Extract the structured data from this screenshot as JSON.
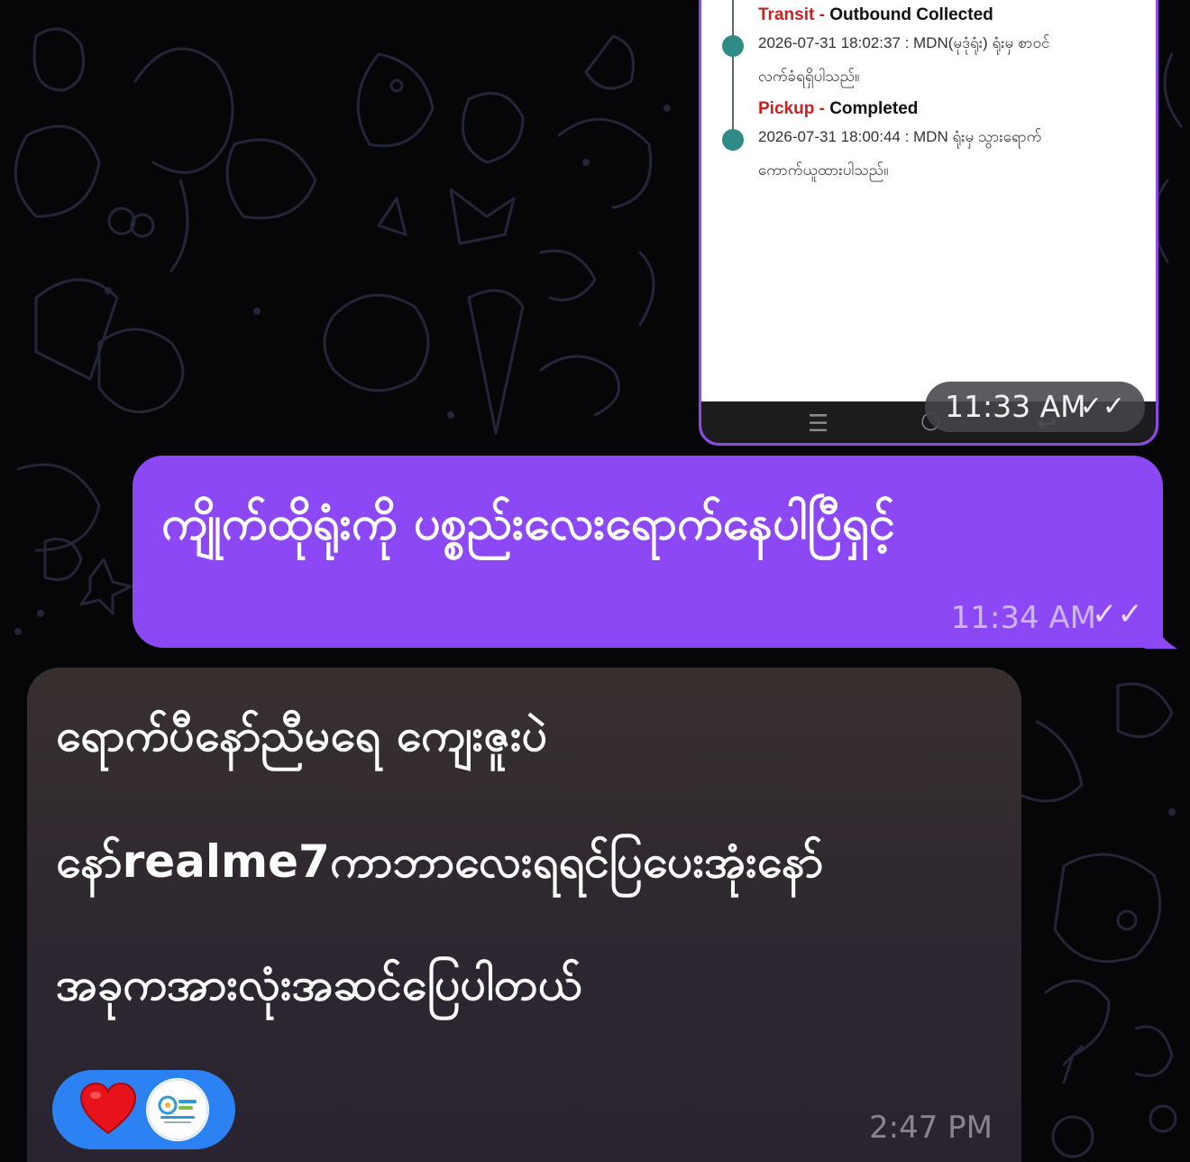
{
  "chat": {
    "image_message": {
      "tracking": [
        {
          "stage": "Transit",
          "dash": "-",
          "status": "Outbound Collected",
          "detail": "2026-07-31 18:02:37 : MDN(မုဒုံရုံး) ရုံးမှ စာဝင်\nလက်ခံရရှိပါသည်။"
        },
        {
          "stage": "Pickup",
          "dash": "-",
          "status": "Completed",
          "detail": "2026-07-31 18:00:44 : MDN ရုံးမှ သွားရောက်\nကောက်ယူထားပါသည်။"
        }
      ],
      "nav_icons": [
        "menu-icon",
        "home-circle-icon",
        "back-icon"
      ],
      "time": "11:33 AM",
      "ticks": "✓✓"
    },
    "outgoing_message": {
      "text": "ကျိုက်ထိုရုံးကို ပစ္စည်းလေးရောက်နေပါပြီရှင့်",
      "time": "11:34 AM",
      "ticks": "✓✓"
    },
    "incoming_message": {
      "lines": [
        "ရောက်ပီနော်ညီမရေ ကျေးဇူးပဲ",
        "နော်realme7ကာဘာလေးရရင်ပြပေးအုံးနော်",
        "အခုကအားလုံးအဆင်ပြေပါတယ်"
      ],
      "reaction": {
        "emoji": "heart-icon",
        "reactor": "avatar"
      },
      "time": "2:47 PM"
    }
  },
  "colors": {
    "background": "#060608",
    "outgoing_bubble": "#8d48f5",
    "incoming_bubble": "#2e2830",
    "reaction_pill": "#2c82f2",
    "tracking_stage": "#cc1f1f",
    "timeline_dot": "#2f8b86"
  }
}
